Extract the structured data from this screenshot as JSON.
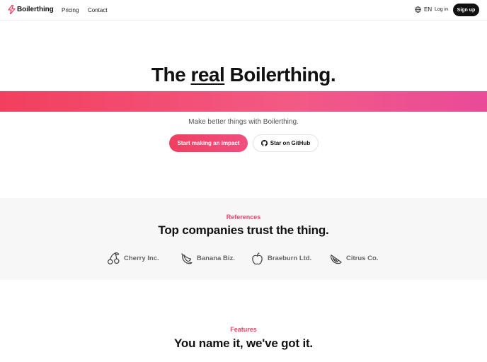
{
  "brand": {
    "name": "Boilerthing",
    "accent": "#ef3f60"
  },
  "nav": {
    "links": [
      "Pricing",
      "Contact"
    ],
    "language": "EN",
    "login": "Log in",
    "signup": "Sign up"
  },
  "hero": {
    "title_prefix": "The ",
    "title_highlight": "real",
    "title_suffix": " Boilerthing.",
    "subtitle": "Make better things with Boilerthing.",
    "primary_cta": "Start making an impact",
    "secondary_cta": "Star on GitHub"
  },
  "references": {
    "eyebrow": "References",
    "title": "Top companies trust the thing.",
    "logos": [
      {
        "icon": "cherry-icon",
        "name": "Cherry Inc."
      },
      {
        "icon": "banana-icon",
        "name": "Banana Biz."
      },
      {
        "icon": "apple-icon",
        "name": "Braeburn Ltd."
      },
      {
        "icon": "citrus-icon",
        "name": "Citrus Co."
      }
    ]
  },
  "features": {
    "eyebrow": "Features",
    "title": "You name it, we've got it."
  }
}
